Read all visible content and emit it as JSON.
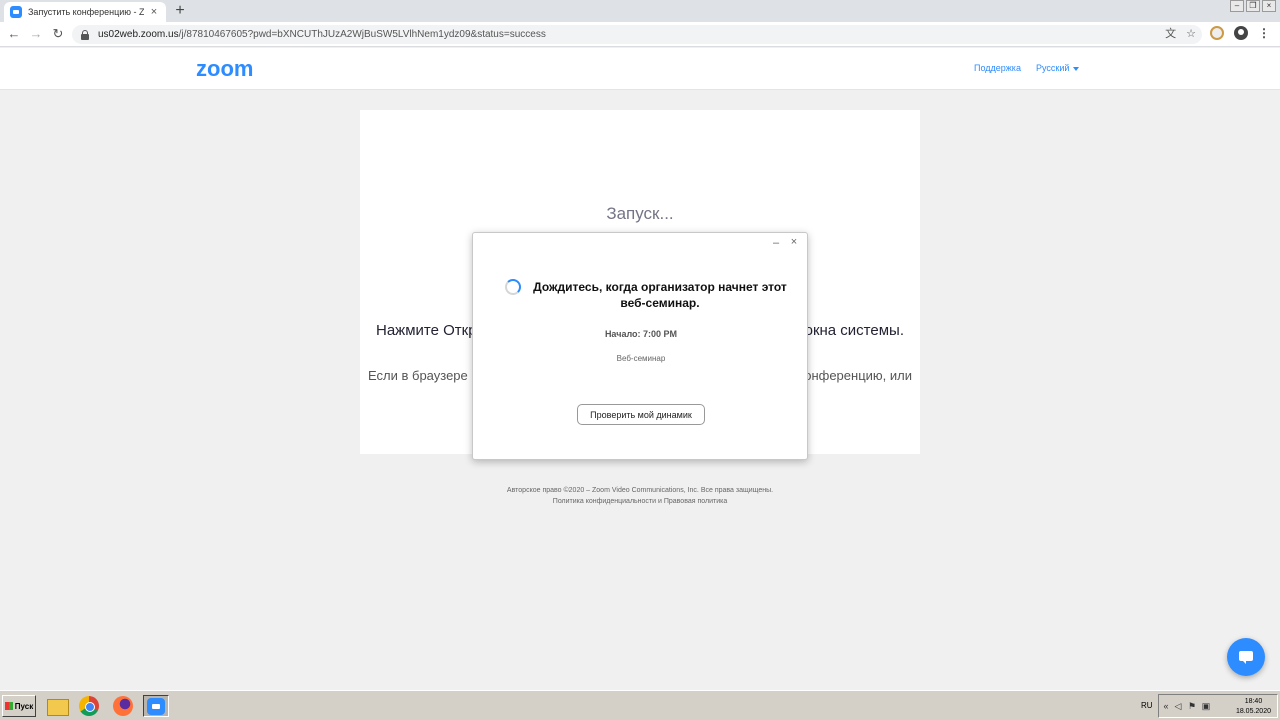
{
  "browser": {
    "tab_title": "Запустить конференцию - Zoom",
    "tab_close": "×",
    "new_tab": "+",
    "url_host": "us02web.zoom.us",
    "url_path": "/j/87810467605?pwd=bXNCUThJUzA2WjBuSW5LVlhNem1ydz09&status=success",
    "window_controls": [
      "–",
      "❐",
      "×"
    ]
  },
  "header": {
    "logo": "zoom",
    "support_link": "Поддержка",
    "language": "Русский"
  },
  "main": {
    "launching": "Запуск...",
    "prompt_left": "Нажмите Откр",
    "prompt_right": "окна системы.",
    "note_left": "Если в браузере не",
    "note_right": "конференцию, или"
  },
  "footer": {
    "copyright": "Авторское право ©2020 – Zoom Video Communications, Inc. Все права защищены.",
    "policies": "Политика конфиденциальности и Правовая политика"
  },
  "dialog": {
    "minimize": "–",
    "close": "×",
    "message": "Дождитесь, когда организатор начнет этот веб-семинар.",
    "start_time": "Начало: 7:00 PM",
    "webinar_label": "Веб-семинар",
    "test_speaker_button": "Проверить мой динамик"
  },
  "taskbar": {
    "start_label": "Пуск",
    "language": "RU",
    "time": "18:40",
    "date": "18.05.2020"
  },
  "colors": {
    "accent": "#2d8cff",
    "page_bg": "#f0f0f0"
  }
}
